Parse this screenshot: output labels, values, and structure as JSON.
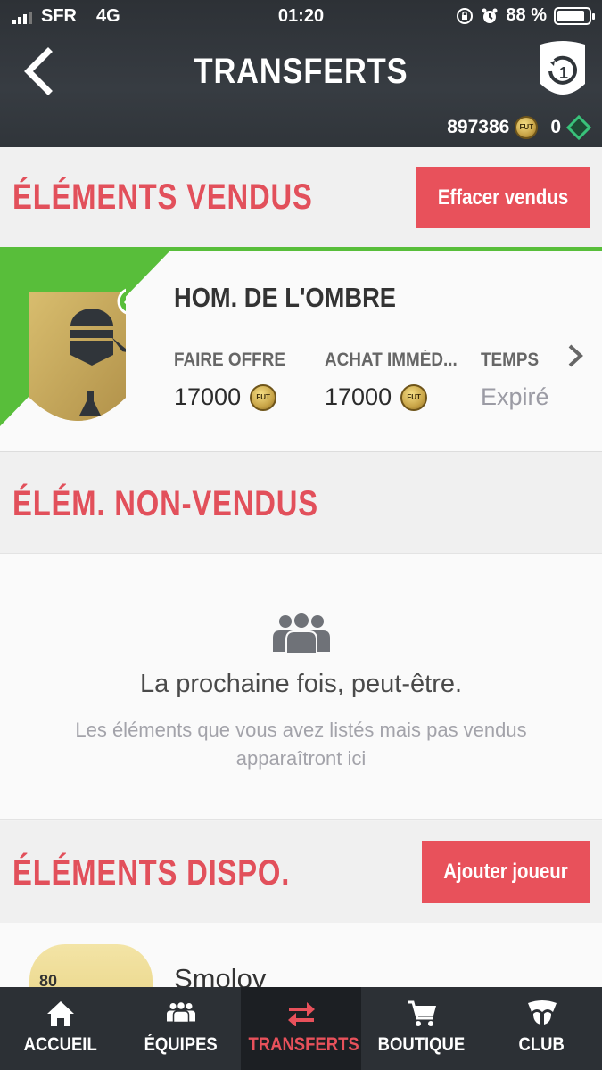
{
  "status_bar": {
    "carrier": "SFR",
    "network": "4G",
    "time": "01:20",
    "battery": "88 %"
  },
  "header": {
    "title": "TRANSFERTS",
    "coins": "897386",
    "coin_label": "FUT",
    "points": "0"
  },
  "sold_section": {
    "title": "ÉLÉMENTS VENDUS",
    "clear_button": "Effacer vendus",
    "item": {
      "name": "HOM. DE L'OMBRE",
      "bid_label": "FAIRE OFFRE",
      "bid_value": "17000",
      "buy_now_label": "ACHAT IMMÉD...",
      "buy_now_value": "17000",
      "time_label": "TEMPS",
      "time_value": "Expiré"
    }
  },
  "unsold_section": {
    "title": "ÉLÉM. NON-VENDUS",
    "empty_title": "La prochaine fois, peut-être.",
    "empty_text": "Les éléments que vous avez listés mais pas vendus apparaîtront ici"
  },
  "available_section": {
    "title": "ÉLÉMENTS DISPO.",
    "add_button": "Ajouter joueur",
    "item": {
      "rating": "80",
      "name": "Smolov"
    }
  },
  "tabs": [
    {
      "label": "ACCUEIL",
      "icon": "home-icon"
    },
    {
      "label": "ÉQUIPES",
      "icon": "teams-icon"
    },
    {
      "label": "TRANSFERTS",
      "icon": "transfers-icon",
      "active": true
    },
    {
      "label": "BOUTIQUE",
      "icon": "cart-icon"
    },
    {
      "label": "CLUB",
      "icon": "club-icon"
    }
  ],
  "colors": {
    "accent": "#e8515b",
    "sold_green": "#58be3a",
    "header_bg": "#30353a"
  }
}
